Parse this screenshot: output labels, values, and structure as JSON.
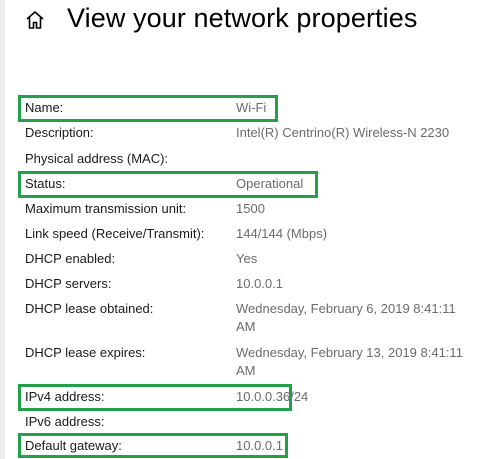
{
  "header": {
    "title": "View your network properties",
    "icon": "home-icon"
  },
  "properties": [
    {
      "label": "Name:",
      "value": "Wi-Fi"
    },
    {
      "label": "Description:",
      "value": "Intel(R) Centrino(R) Wireless-N 2230"
    },
    {
      "label": "Physical address (MAC):",
      "value": ""
    },
    {
      "label": "Status:",
      "value": "Operational"
    },
    {
      "label": "Maximum transmission unit:",
      "value": "1500"
    },
    {
      "label": "Link speed (Receive/Transmit):",
      "value": "144/144 (Mbps)"
    },
    {
      "label": "DHCP enabled:",
      "value": "Yes"
    },
    {
      "label": "DHCP servers:",
      "value": "10.0.0.1"
    },
    {
      "label": "DHCP lease obtained:",
      "value": "Wednesday, February 6, 2019 8:41:11 AM"
    },
    {
      "label": "DHCP lease expires:",
      "value": "Wednesday, February 13, 2019 8:41:11 AM"
    },
    {
      "label": "IPv4 address:",
      "value": "10.0.0.36/24"
    },
    {
      "label": "IPv6 address:",
      "value": ""
    },
    {
      "label": "Default gateway:",
      "value": "10.0.0.1"
    }
  ],
  "highlight_color": "#22a04a"
}
